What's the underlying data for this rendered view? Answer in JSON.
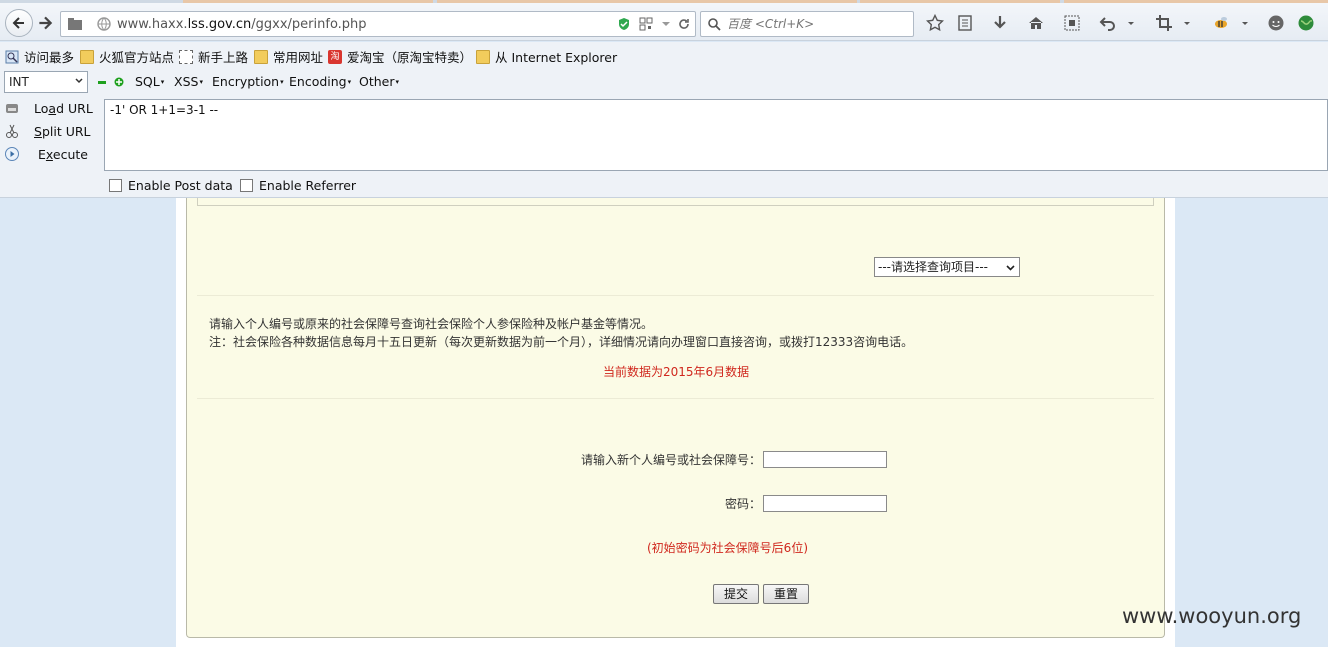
{
  "browser": {
    "url_host": "www.haxx.",
    "url_domain": "lss.gov.cn",
    "url_path": "/ggxx/perinfo.php",
    "search_placeholder": "百度 <Ctrl+K>"
  },
  "bookmarks": [
    {
      "label": "访问最多",
      "icon": "most-visited-icon"
    },
    {
      "label": "火狐官方站点",
      "icon": "folder-icon"
    },
    {
      "label": "新手上路",
      "icon": "dashed-page-icon"
    },
    {
      "label": "常用网址",
      "icon": "folder-icon"
    },
    {
      "label": "爱淘宝（原淘宝特卖）",
      "icon": "taobao-icon"
    },
    {
      "label": "从 Internet Explorer",
      "icon": "folder-icon"
    }
  ],
  "hackbar": {
    "type_select": "INT",
    "menus": [
      "SQL",
      "XSS",
      "Encryption",
      "Encoding",
      "Other"
    ],
    "actions": {
      "load_url": {
        "pre": "Lo",
        "key": "a",
        "post": "d URL"
      },
      "split_url": {
        "pre": "",
        "key": "S",
        "post": "plit URL"
      },
      "execute": {
        "pre": "E",
        "key": "x",
        "post": "ecute"
      }
    },
    "payload": "-1' OR 1+1=3-1 --",
    "post_data_label": "Enable Post data",
    "referrer_label": "Enable Referrer"
  },
  "page": {
    "query_select": "---请选择查询项目---",
    "info_line1": "请输入个人编号或原来的社会保障号查询社会保险个人参保险种及帐户基金等情况。",
    "info_line2": "注：社会保险各种数据信息每月十五日更新（每次更新数据为前一个月），详细情况请向办理窗口直接咨询，或拨打12333咨询电话。",
    "data_month": "当前数据为2015年6月数据",
    "id_label": "请输入新个人编号或社会保障号：",
    "password_label": "密码：",
    "password_hint": "(初始密码为社会保障号后6位)",
    "submit_label": "提交",
    "reset_label": "重置"
  },
  "watermark": "www.wooyun.org",
  "colors": {
    "panel_bg": "#fbfbe6",
    "red_text": "#d0281e",
    "page_bg": "#dbe8f5"
  }
}
